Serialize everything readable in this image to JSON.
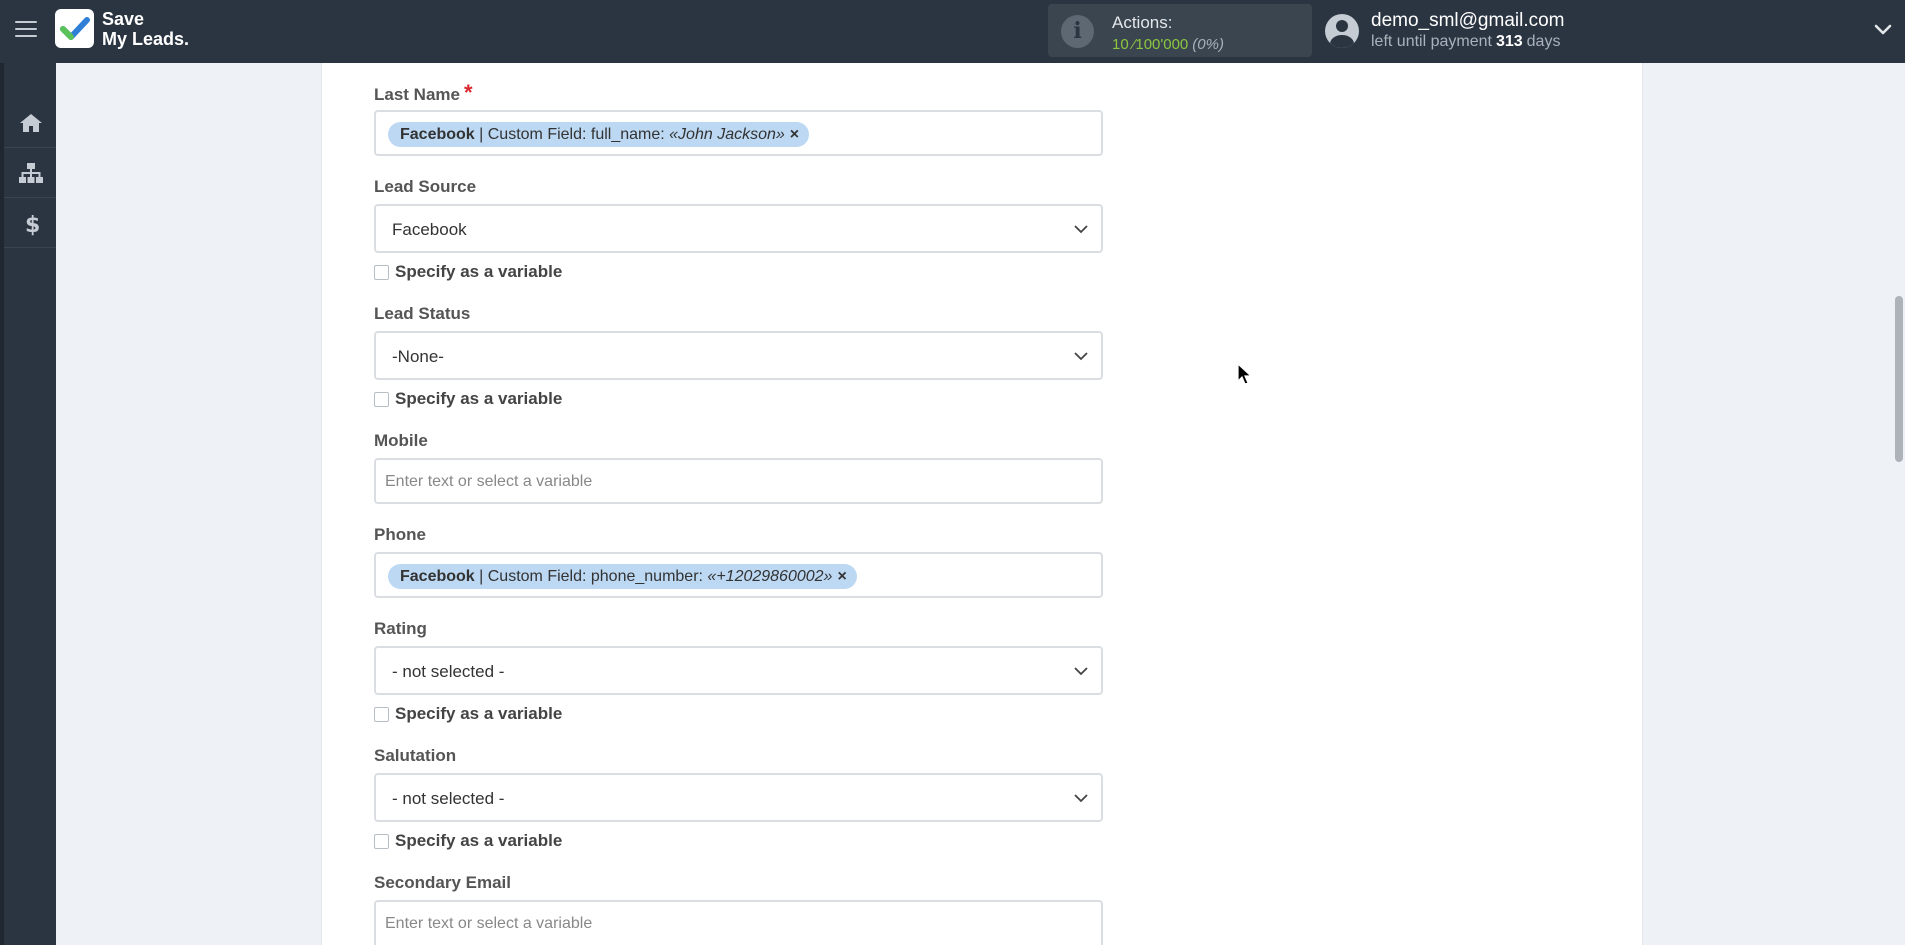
{
  "app": {
    "logo_line1": "Save",
    "logo_line2": "My Leads.",
    "brand_color": "#2b3541",
    "accent_color": "#8dc63f"
  },
  "header": {
    "actions_label": "Actions:",
    "actions_count": "10 ⁄100'000",
    "actions_percent": "(0%)",
    "user_email": "demo_sml@gmail.com",
    "payment_prefix": "left until payment",
    "payment_days": "313",
    "payment_suffix": "days"
  },
  "sidebar": {
    "items": [
      {
        "icon": "home-icon"
      },
      {
        "icon": "sitemap-icon"
      },
      {
        "icon": "dollar-icon"
      }
    ]
  },
  "form": {
    "last_name": {
      "label": "Last Name",
      "required_mark": "*",
      "tag_source": "Facebook",
      "tag_field": "| Custom Field: full_name:",
      "tag_value": "«John Jackson»",
      "tag_remove": "×"
    },
    "lead_source": {
      "label": "Lead Source",
      "value": "Facebook",
      "checkbox_label": "Specify as a variable"
    },
    "lead_status": {
      "label": "Lead Status",
      "value": "-None-",
      "checkbox_label": "Specify as a variable"
    },
    "mobile": {
      "label": "Mobile",
      "placeholder": "Enter text or select a variable"
    },
    "phone": {
      "label": "Phone",
      "tag_source": "Facebook",
      "tag_field": "| Custom Field: phone_number:",
      "tag_value": "«+12029860002»",
      "tag_remove": "×"
    },
    "rating": {
      "label": "Rating",
      "value": "- not selected -",
      "checkbox_label": "Specify as a variable"
    },
    "salutation": {
      "label": "Salutation",
      "value": "- not selected -",
      "checkbox_label": "Specify as a variable"
    },
    "secondary_email": {
      "label": "Secondary Email",
      "placeholder": "Enter text or select a variable"
    }
  }
}
